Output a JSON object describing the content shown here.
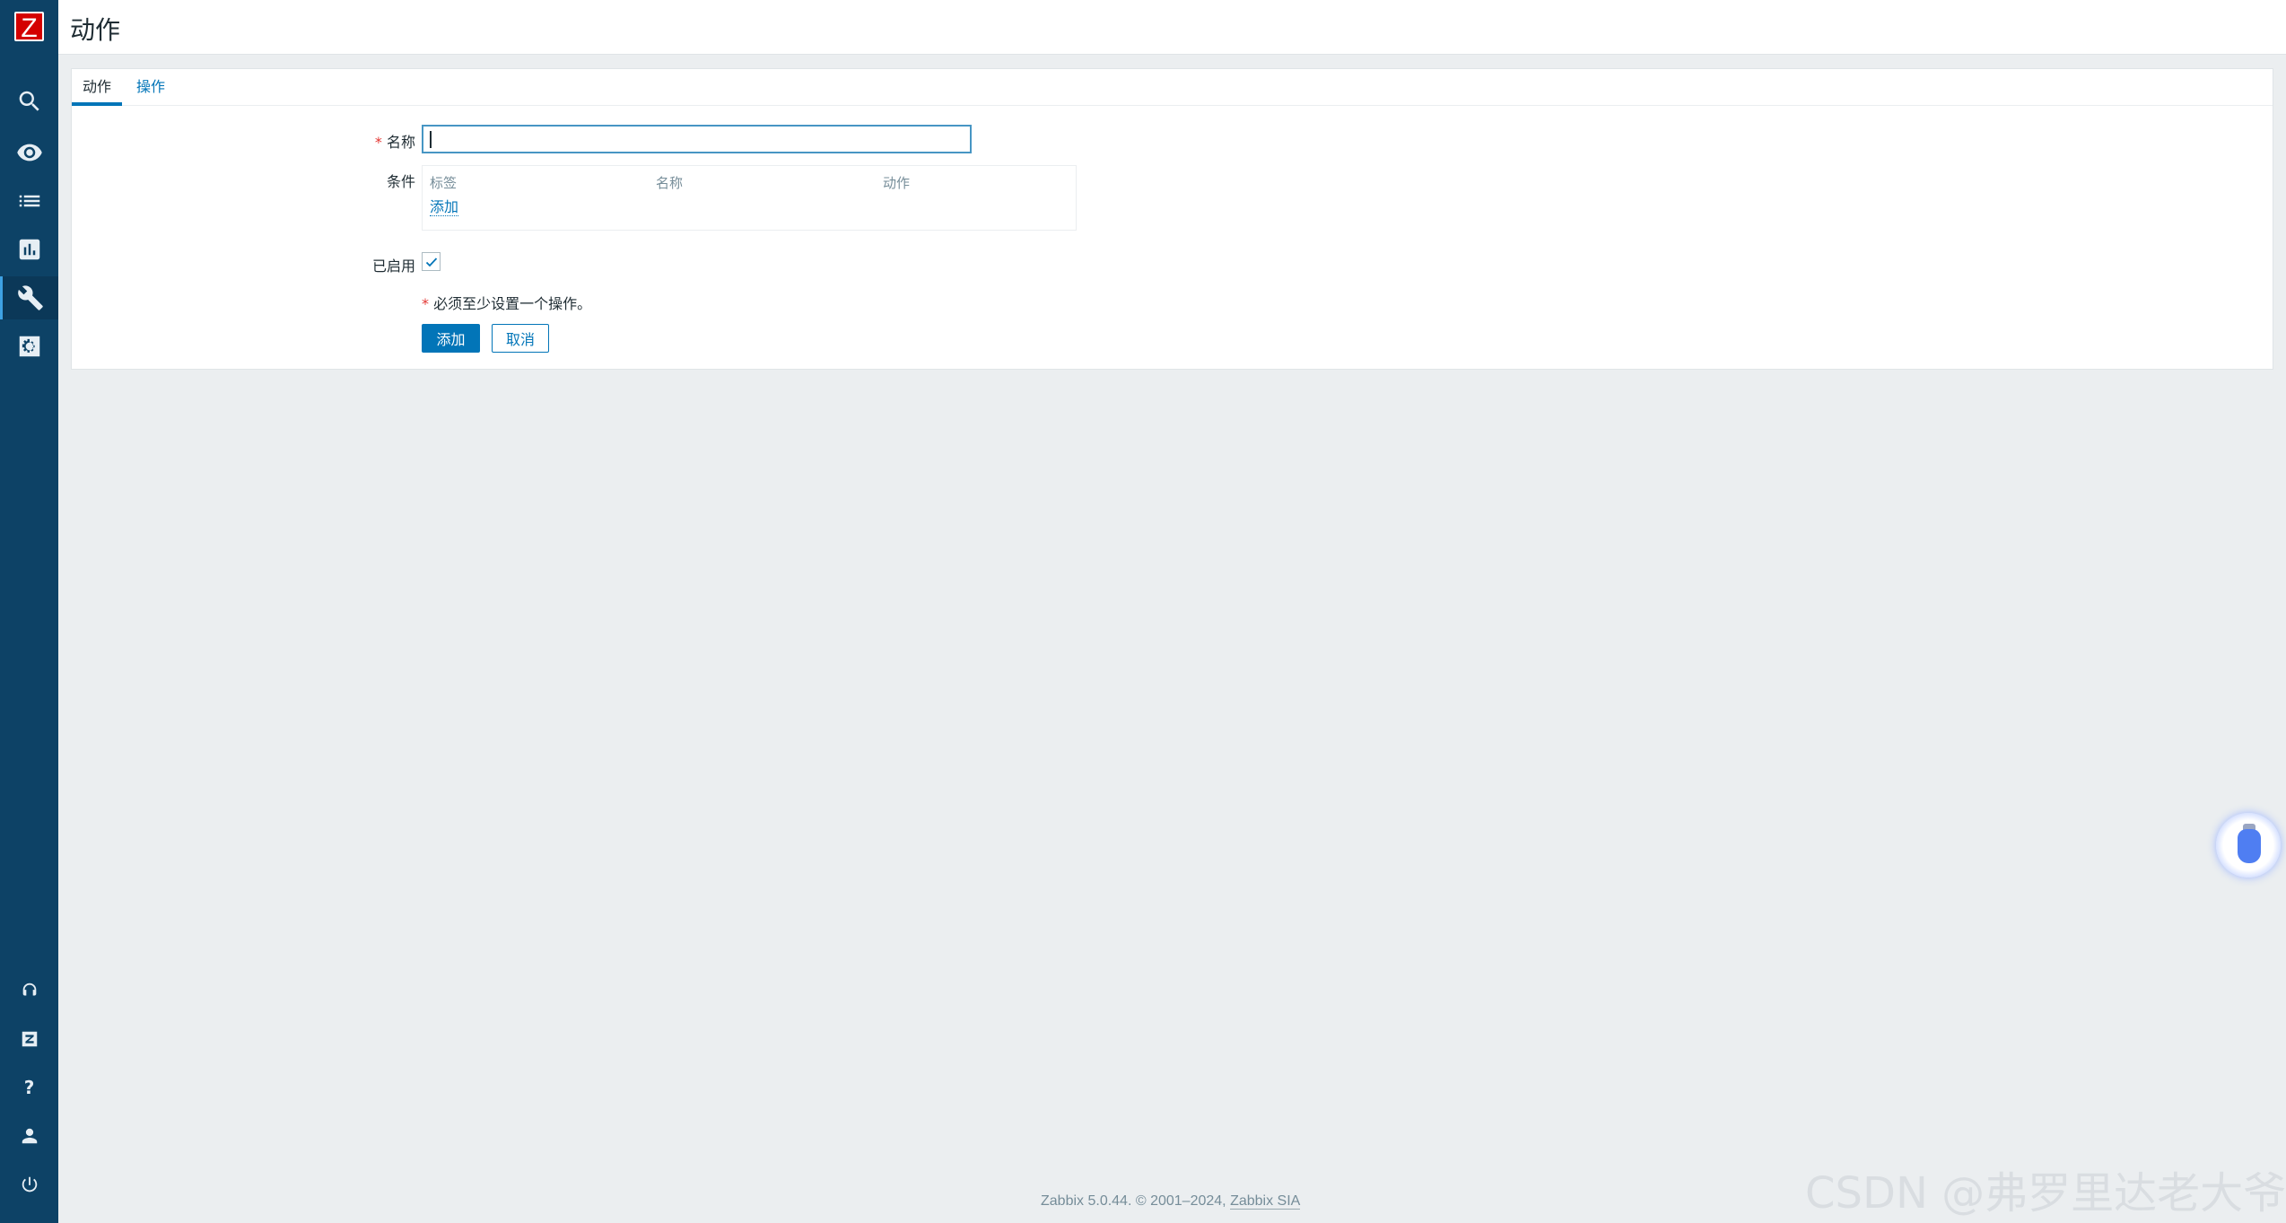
{
  "app": {
    "logo_letter": "Z",
    "brand_color": "#d40000",
    "accent_color": "#0275b8"
  },
  "header": {
    "title": "动作"
  },
  "sidebar": {
    "top_icons": [
      "search-icon",
      "eye-icon",
      "list-icon",
      "chart-icon",
      "wrench-icon",
      "gear-icon"
    ],
    "active_icon": "wrench-icon",
    "bottom_icons": [
      "support-icon",
      "zabbix-share-icon",
      "help-icon",
      "user-icon",
      "logout-icon"
    ],
    "help_glyph": "?"
  },
  "tabs": [
    {
      "label": "动作",
      "active": true
    },
    {
      "label": "操作",
      "active": false
    }
  ],
  "form": {
    "required_marker": "*",
    "name_label": "名称",
    "name_value": "",
    "conditions_label": "条件",
    "conditions_columns": [
      "标签",
      "名称",
      "动作"
    ],
    "conditions_add_link": "添加",
    "enabled_label": "已启用",
    "enabled_checked": true,
    "note": "必须至少设置一个操作。",
    "submit_label": "添加",
    "cancel_label": "取消"
  },
  "footer": {
    "text": "Zabbix 5.0.44. © 2001–2024, ",
    "link": "Zabbix SIA"
  },
  "watermark": "CSDN @弗罗里达老大爷"
}
